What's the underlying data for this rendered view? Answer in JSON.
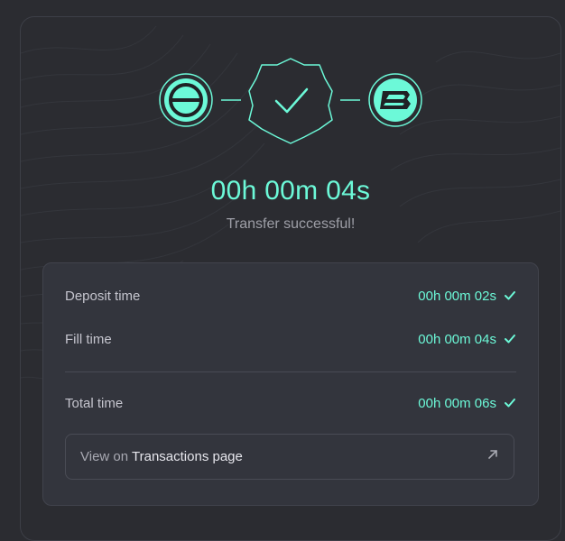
{
  "route": {
    "from_chain_icon": "circle-minus-logo-icon",
    "status_icon": "badge-check-icon",
    "to_chain_icon": "blast-b-logo-icon"
  },
  "timer": "00h 00m 04s",
  "status_message": "Transfer successful!",
  "details": {
    "rows": [
      {
        "label": "Deposit time",
        "value": "00h 00m 02s",
        "icon": "check-icon"
      },
      {
        "label": "Fill time",
        "value": "00h 00m 04s",
        "icon": "check-icon"
      },
      {
        "label": "Total time",
        "value": "00h 00m 06s",
        "icon": "check-icon"
      }
    ]
  },
  "transactions_link": {
    "prefix": "View on ",
    "page": "Transactions page",
    "icon": "arrow-up-right-icon"
  },
  "colors": {
    "accent": "#6cf9d8",
    "background": "#2b2c31",
    "panel": "#33353d"
  }
}
